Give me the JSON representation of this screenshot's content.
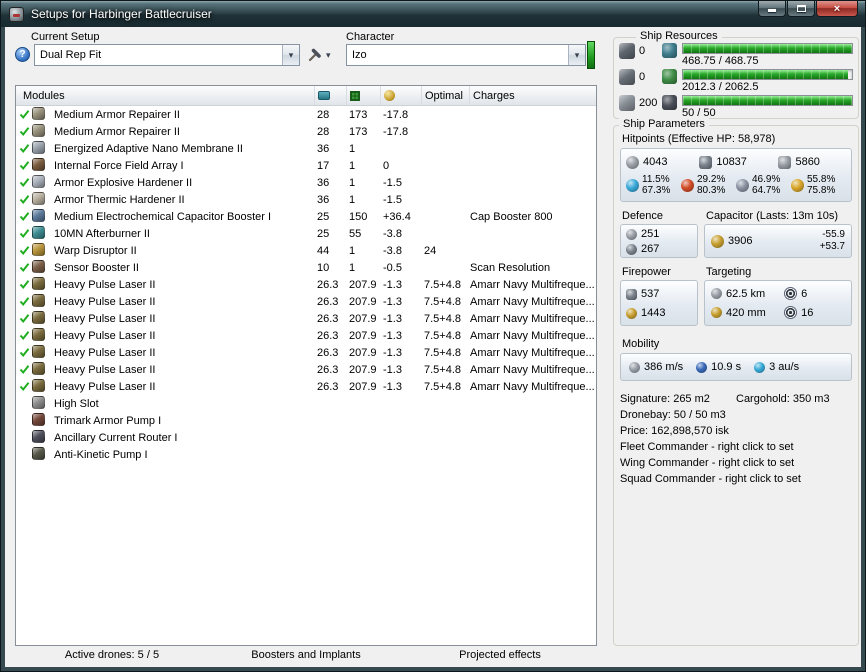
{
  "window": {
    "title": "Setups for Harbinger Battlecruiser"
  },
  "icons": {
    "dropdown_arrow": "▾",
    "help": "?",
    "close_glyph": "×"
  },
  "toolbar": {
    "current_setup_label": "Current Setup",
    "current_setup_value": "Dual Rep Fit",
    "character_label": "Character",
    "character_value": "Izo"
  },
  "modules": {
    "header": {
      "modules": "Modules",
      "optimal": "Optimal",
      "charges": "Charges"
    },
    "rows": [
      {
        "fitted": true,
        "name": "Medium Armor Repairer II",
        "cpu": "28",
        "pg": "173",
        "cap": "-17.8",
        "optimal": "",
        "charges": "",
        "color": "#98917c"
      },
      {
        "fitted": true,
        "name": "Medium Armor Repairer II",
        "cpu": "28",
        "pg": "173",
        "cap": "-17.8",
        "optimal": "",
        "charges": "",
        "color": "#98917c"
      },
      {
        "fitted": true,
        "name": "Energized Adaptive Nano Membrane II",
        "cpu": "36",
        "pg": "1",
        "cap": "",
        "optimal": "",
        "charges": "",
        "color": "#9aa2ac"
      },
      {
        "fitted": true,
        "name": "Internal Force Field Array I",
        "cpu": "17",
        "pg": "1",
        "cap": "0",
        "optimal": "",
        "charges": "",
        "color": "#7a5c3e"
      },
      {
        "fitted": true,
        "name": "Armor Explosive Hardener II",
        "cpu": "36",
        "pg": "1",
        "cap": "-1.5",
        "optimal": "",
        "charges": "",
        "color": "#aab0ba"
      },
      {
        "fitted": true,
        "name": "Armor Thermic Hardener II",
        "cpu": "36",
        "pg": "1",
        "cap": "-1.5",
        "optimal": "",
        "charges": "",
        "color": "#b8b0a0"
      },
      {
        "fitted": true,
        "name": "Medium Electrochemical Capacitor Booster I",
        "cpu": "25",
        "pg": "150",
        "cap": "+36.4",
        "optimal": "",
        "charges": "Cap Booster 800",
        "color": "#5c7a9c"
      },
      {
        "fitted": true,
        "name": "10MN Afterburner II",
        "cpu": "25",
        "pg": "55",
        "cap": "-3.8",
        "optimal": "",
        "charges": "",
        "color": "#3d8d93"
      },
      {
        "fitted": true,
        "name": "Warp Disruptor II",
        "cpu": "44",
        "pg": "1",
        "cap": "-3.8",
        "optimal": "24",
        "charges": "",
        "color": "#b9953b"
      },
      {
        "fitted": true,
        "name": "Sensor Booster II",
        "cpu": "10",
        "pg": "1",
        "cap": "-0.5",
        "optimal": "",
        "charges": "Scan Resolution",
        "color": "#7b5f49"
      },
      {
        "fitted": true,
        "name": "Heavy Pulse Laser II",
        "cpu": "26.3",
        "pg": "207.9",
        "cap": "-1.3",
        "optimal": "7.5+4.8",
        "charges": "Amarr Navy Multifreque...",
        "color": "#7b6c3e"
      },
      {
        "fitted": true,
        "name": "Heavy Pulse Laser II",
        "cpu": "26.3",
        "pg": "207.9",
        "cap": "-1.3",
        "optimal": "7.5+4.8",
        "charges": "Amarr Navy Multifreque...",
        "color": "#7b6c3e"
      },
      {
        "fitted": true,
        "name": "Heavy Pulse Laser II",
        "cpu": "26.3",
        "pg": "207.9",
        "cap": "-1.3",
        "optimal": "7.5+4.8",
        "charges": "Amarr Navy Multifreque...",
        "color": "#7b6c3e"
      },
      {
        "fitted": true,
        "name": "Heavy Pulse Laser II",
        "cpu": "26.3",
        "pg": "207.9",
        "cap": "-1.3",
        "optimal": "7.5+4.8",
        "charges": "Amarr Navy Multifreque...",
        "color": "#7b6c3e"
      },
      {
        "fitted": true,
        "name": "Heavy Pulse Laser II",
        "cpu": "26.3",
        "pg": "207.9",
        "cap": "-1.3",
        "optimal": "7.5+4.8",
        "charges": "Amarr Navy Multifreque...",
        "color": "#7b6c3e"
      },
      {
        "fitted": true,
        "name": "Heavy Pulse Laser II",
        "cpu": "26.3",
        "pg": "207.9",
        "cap": "-1.3",
        "optimal": "7.5+4.8",
        "charges": "Amarr Navy Multifreque...",
        "color": "#7b6c3e"
      },
      {
        "fitted": true,
        "name": "Heavy Pulse Laser II",
        "cpu": "26.3",
        "pg": "207.9",
        "cap": "-1.3",
        "optimal": "7.5+4.8",
        "charges": "Amarr Navy Multifreque...",
        "color": "#7b6c3e"
      },
      {
        "fitted": false,
        "name": "High Slot",
        "cpu": "",
        "pg": "",
        "cap": "",
        "optimal": "",
        "charges": "",
        "color": "#8f8f8f"
      },
      {
        "fitted": false,
        "name": "Trimark Armor Pump I",
        "cpu": "",
        "pg": "",
        "cap": "",
        "optimal": "",
        "charges": "",
        "color": "#74473a"
      },
      {
        "fitted": false,
        "name": "Ancillary Current Router I",
        "cpu": "",
        "pg": "",
        "cap": "",
        "optimal": "",
        "charges": "",
        "color": "#4f505c"
      },
      {
        "fitted": false,
        "name": "Anti-Kinetic Pump I",
        "cpu": "",
        "pg": "",
        "cap": "",
        "optimal": "",
        "charges": "",
        "color": "#57584a"
      }
    ]
  },
  "bottom_sections": [
    {
      "name": "active-drones-header",
      "label": "Active drones: 5 / 5"
    },
    {
      "name": "boosters-implants-header",
      "label": "Boosters and Implants"
    },
    {
      "name": "projected-effects-header",
      "label": "Projected effects"
    }
  ],
  "resources": {
    "label": "Ship Resources",
    "rows": [
      {
        "icon_name": "turret-hardpoints-icon",
        "icon_color": "#5f666e",
        "value": "0",
        "bar_icon": "cpu-icon",
        "bar_icon_color": "#3f7d8c",
        "bar_text": "468.75 / 468.75",
        "pct": 100
      },
      {
        "icon_name": "launcher-hardpoints-icon",
        "icon_color": "#6a7078",
        "value": "0",
        "bar_icon": "powergrid-icon",
        "bar_icon_color": "#3f8c46",
        "bar_text": "2012.3 / 2062.5",
        "pct": 97.6
      },
      {
        "icon_name": "calibration-icon",
        "icon_color": "#8a9098",
        "value": "200",
        "bar_icon": "drone-icon",
        "bar_icon_color": "#4a4e58",
        "bar_text": "50 / 50",
        "pct": 100
      }
    ],
    "bar_color": "#2aa82a"
  },
  "parameters": {
    "label": "Ship Parameters",
    "hitpoints_label": "Hitpoints (Effective HP: 58,978)",
    "hp": {
      "shield": "4043",
      "armor": "10837",
      "hull": "5860"
    },
    "resists": [
      {
        "icon": "em-resist-icon",
        "color": "#3aa9d9",
        "top": "11.5%",
        "bottom": "67.3%"
      },
      {
        "icon": "thermal-resist-icon",
        "color": "#d24d28",
        "top": "29.2%",
        "bottom": "80.3%"
      },
      {
        "icon": "kinetic-resist-icon",
        "color": "#8b93a3",
        "top": "46.9%",
        "bottom": "64.7%"
      },
      {
        "icon": "explosive-resist-icon",
        "color": "#d8a62a",
        "top": "55.8%",
        "bottom": "75.8%"
      }
    ],
    "defence": {
      "label": "Defence",
      "v1": "251",
      "v2": "267"
    },
    "capacitor": {
      "label": "Capacitor (Lasts: 13m 10s)",
      "amount": "3906",
      "out": "-55.9",
      "in": "+53.7"
    },
    "firepower": {
      "label": "Firepower",
      "dps": "537",
      "volley": "1443"
    },
    "targeting": {
      "label": "Targeting",
      "range": "62.5 km",
      "targets": "6",
      "scanres": "420 mm",
      "sensor": "16"
    },
    "mobility": {
      "label": "Mobility",
      "speed": "386 m/s",
      "align": "10.9 s",
      "warp": "3 au/s"
    },
    "info": {
      "signature": "Signature: 265 m2",
      "cargohold": "Cargohold: 350 m3",
      "dronebay": "Dronebay: 50 / 50 m3",
      "price": "Price: 162,898,570 isk",
      "fleet": "Fleet Commander - right click to set",
      "wing": "Wing Commander - right click to set",
      "squad": "Squad Commander - right click to set"
    }
  }
}
